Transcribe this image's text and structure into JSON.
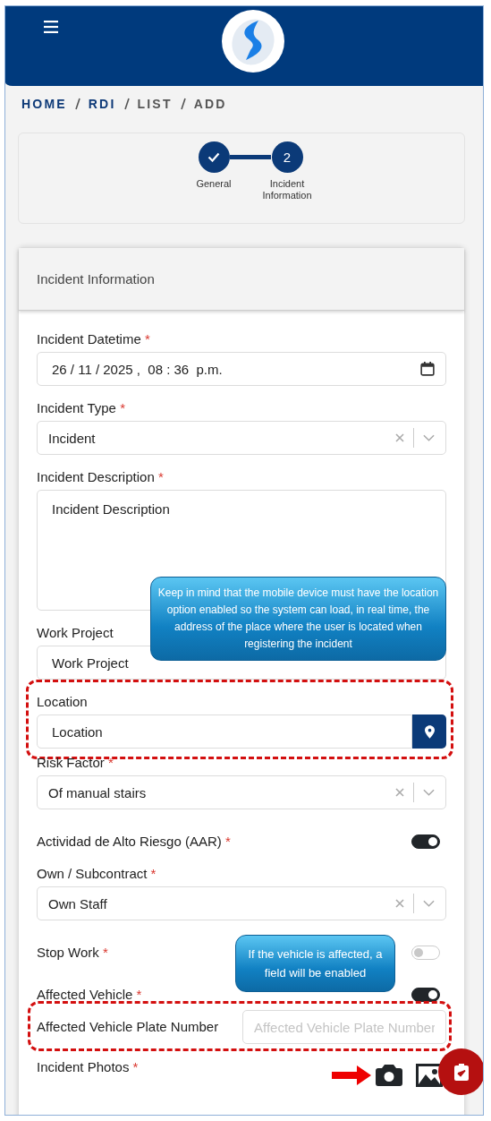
{
  "breadcrumb": [
    {
      "label": "HOME",
      "current": false
    },
    {
      "label": "RDI",
      "current": false
    },
    {
      "label": "LIST",
      "current": true
    },
    {
      "label": "ADD",
      "current": true
    }
  ],
  "stepper": [
    {
      "label": "General",
      "done": true
    },
    {
      "label": "Incident Information",
      "done": false,
      "number": "2"
    }
  ],
  "form": {
    "title": "Incident Information",
    "fields": [
      {
        "kind": "datetime",
        "label": "Incident Datetime",
        "required_mark": "*",
        "value": "26 / 11 / 2025 ,  08 : 36  p.m."
      },
      {
        "kind": "select",
        "label": "Incident Type",
        "required_mark": "*",
        "value": "Incident"
      },
      {
        "kind": "textarea",
        "label": "Incident Description",
        "required_mark": "*",
        "value": "Incident Description"
      },
      {
        "kind": "text",
        "label": "Work Project",
        "value": "Work Project"
      },
      {
        "kind": "location",
        "label": "Location",
        "value": "Location",
        "highlighted": true,
        "callout": "Keep in mind that the mobile device must have the location option enabled so the system can load, in real time, the address of the place where the user is located when registering the incident"
      },
      {
        "kind": "select",
        "label": "Risk Factor",
        "required_mark": "*",
        "value": "Of manual stairs"
      },
      {
        "kind": "toggle",
        "label": "Actividad de Alto Riesgo (AAR)",
        "required_mark": "*",
        "on": true
      },
      {
        "kind": "select",
        "label": "Own / Subcontract",
        "required_mark": "*",
        "value": "Own Staff"
      },
      {
        "kind": "toggle",
        "label": "Stop Work",
        "required_mark": "*",
        "on": false
      },
      {
        "kind": "toggle",
        "label": "Affected Vehicle",
        "required_mark": "*",
        "on": true,
        "callout": "If the vehicle is affected, a field will be enabled"
      },
      {
        "kind": "inline-text",
        "label": "Affected Vehicle Plate Number",
        "placeholder": "Affected Vehicle Plate Number",
        "highlighted": true
      },
      {
        "kind": "photos",
        "label": "Incident Photos",
        "required_mark": "*",
        "arrow": true
      }
    ]
  }
}
